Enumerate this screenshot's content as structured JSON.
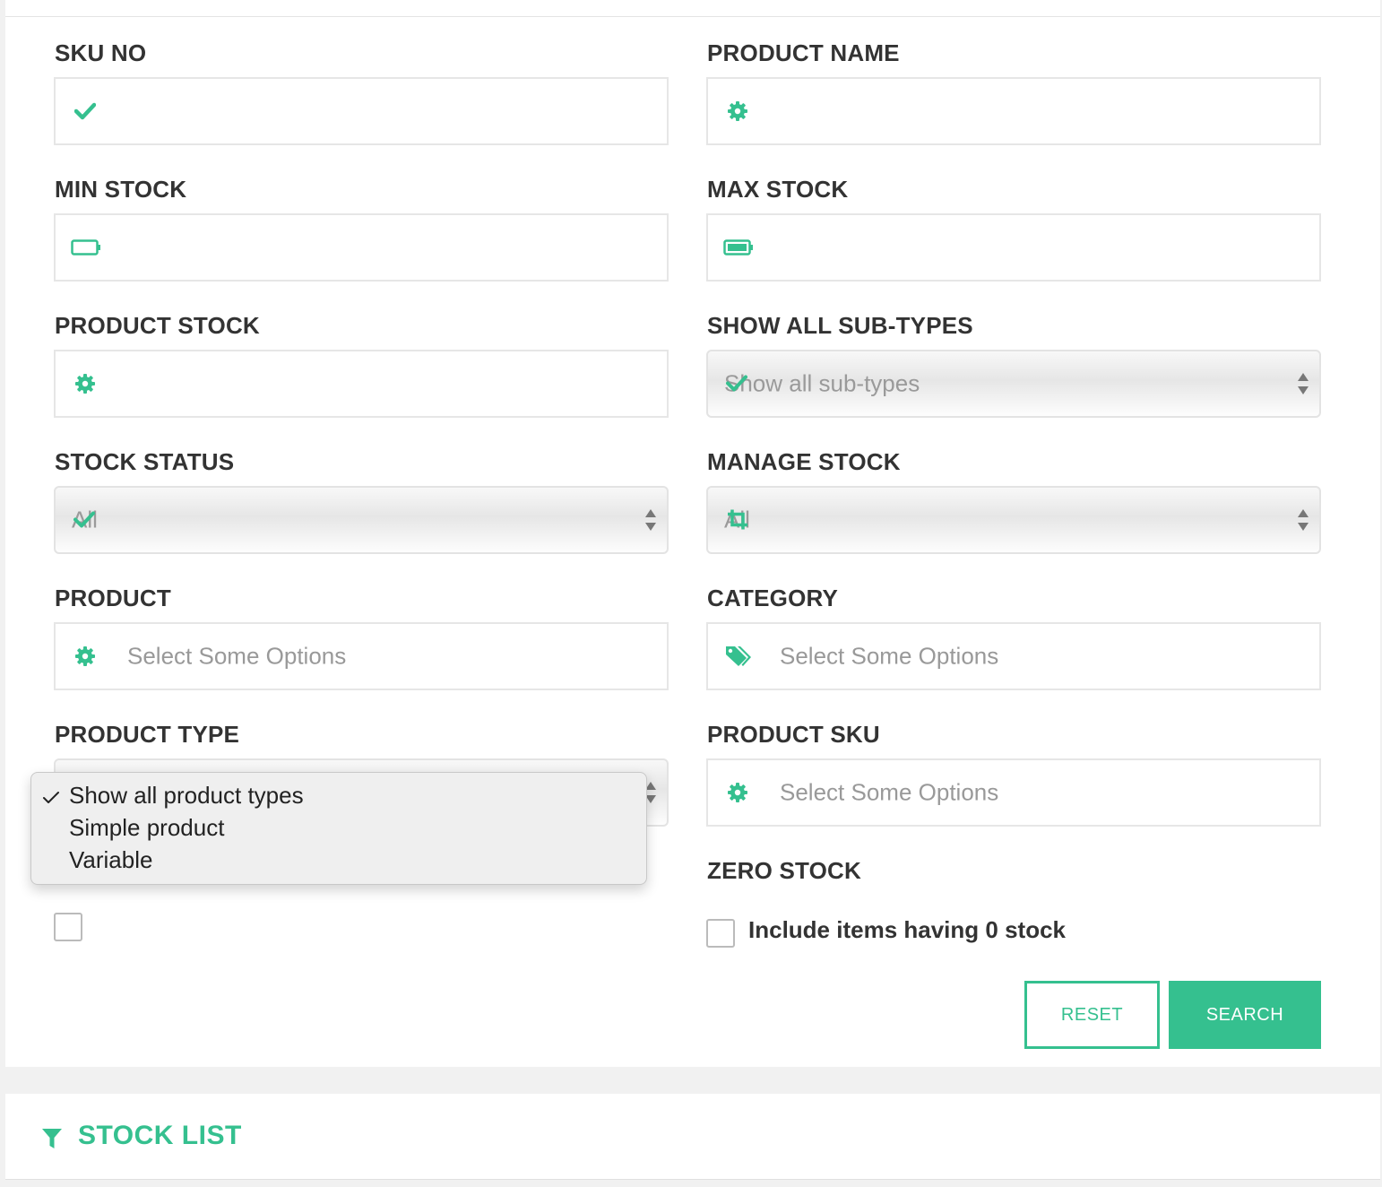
{
  "colors": {
    "accent": "#35c08f",
    "label": "#333333",
    "placeholder": "#999999"
  },
  "filters": {
    "sku_no": {
      "label": "SKU NO",
      "icon": "check-icon"
    },
    "product_name": {
      "label": "PRODUCT NAME",
      "icon": "gear-icon"
    },
    "min_stock": {
      "label": "MIN STOCK",
      "icon": "battery-empty-icon"
    },
    "max_stock": {
      "label": "MAX STOCK",
      "icon": "battery-full-icon"
    },
    "product_stock": {
      "label": "PRODUCT STOCK",
      "icon": "gear-icon"
    },
    "show_all_sub_types": {
      "label": "SHOW ALL SUB-TYPES",
      "value": "Show all sub-types",
      "icon": "check-icon"
    },
    "stock_status": {
      "label": "STOCK STATUS",
      "value": "All",
      "icon": "check-icon"
    },
    "manage_stock": {
      "label": "MANAGE STOCK",
      "value": "All",
      "icon": "crop-icon"
    },
    "product": {
      "label": "PRODUCT",
      "placeholder": "Select Some Options",
      "icon": "gear-icon"
    },
    "category": {
      "label": "CATEGORY",
      "placeholder": "Select Some Options",
      "icon": "tags-icon"
    },
    "product_type": {
      "label": "PRODUCT TYPE",
      "options": [
        "Show all product types",
        "Simple product",
        "Variable"
      ],
      "selected": "Show all product types"
    },
    "product_sku": {
      "label": "PRODUCT SKU",
      "placeholder": "Select Some Options",
      "icon": "gear-icon"
    },
    "zero_stock": {
      "label": "ZERO STOCK",
      "checkbox_label": "Include items having 0 stock",
      "checked": false
    }
  },
  "actions": {
    "reset_label": "RESET",
    "search_label": "SEARCH"
  },
  "stock_list": {
    "title": "STOCK LIST",
    "icon": "filter-icon"
  }
}
